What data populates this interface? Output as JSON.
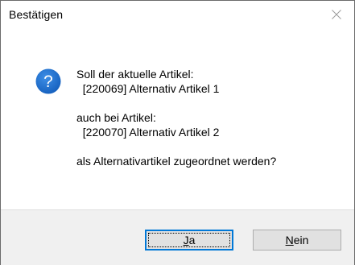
{
  "dialog": {
    "title": "Bestätigen",
    "icon": "question-icon",
    "message_lines": [
      "Soll der aktuelle Artikel:",
      "  [220069] Alternativ Artikel 1",
      "",
      "auch bei Artikel:",
      "  [220070] Alternativ Artikel 2",
      "",
      "als Alternativartikel zugeordnet werden?"
    ],
    "buttons": {
      "yes": {
        "mnemonic": "J",
        "rest": "a"
      },
      "no": {
        "mnemonic": "N",
        "rest": "ein"
      }
    }
  },
  "colors": {
    "accent": "#0078d7",
    "icon_fill": "#1a6fcf",
    "footer_bg": "#f0f0f0",
    "button_bg": "#e1e1e1"
  }
}
